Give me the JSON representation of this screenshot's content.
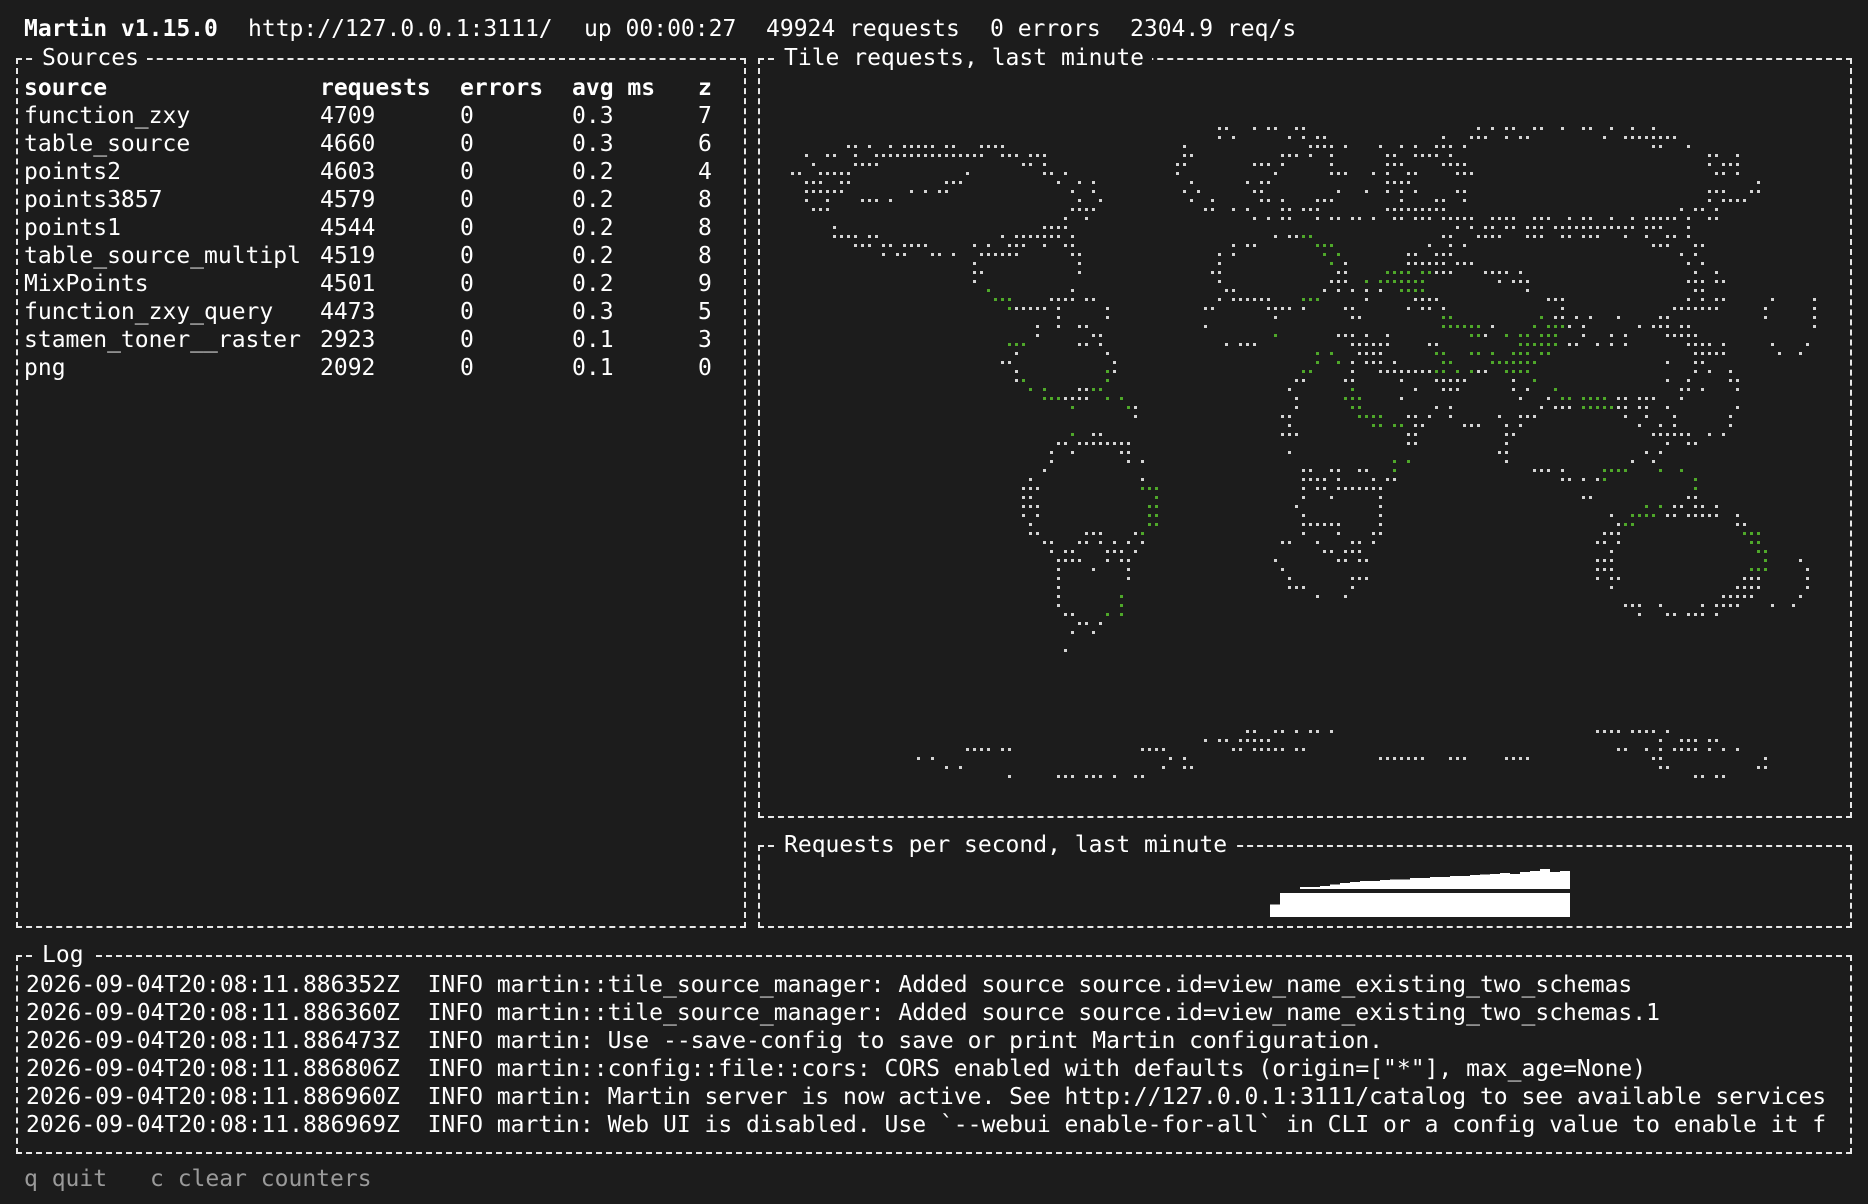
{
  "status": {
    "app": "Martin v1.15.0",
    "url": "http://127.0.0.1:3111/",
    "uptime": "up 00:00:27",
    "requests": "49924 requests",
    "errors": "0 errors",
    "rate": "2304.9 req/s"
  },
  "sources_panel": {
    "title": "Sources",
    "headers": [
      "source",
      "requests",
      "errors",
      "avg ms",
      "z"
    ],
    "rows": [
      {
        "source": "function_zxy",
        "requests": "4709",
        "errors": "0",
        "avg": "0.3",
        "z": "7"
      },
      {
        "source": "table_source",
        "requests": "4660",
        "errors": "0",
        "avg": "0.3",
        "z": "6"
      },
      {
        "source": "points2",
        "requests": "4603",
        "errors": "0",
        "avg": "0.2",
        "z": "4"
      },
      {
        "source": "points3857",
        "requests": "4579",
        "errors": "0",
        "avg": "0.2",
        "z": "8"
      },
      {
        "source": "points1",
        "requests": "4544",
        "errors": "0",
        "avg": "0.2",
        "z": "8"
      },
      {
        "source": "table_source_multipl",
        "requests": "4519",
        "errors": "0",
        "avg": "0.2",
        "z": "8"
      },
      {
        "source": "MixPoints",
        "requests": "4501",
        "errors": "0",
        "avg": "0.2",
        "z": "9"
      },
      {
        "source": "function_zxy_query",
        "requests": "4473",
        "errors": "0",
        "avg": "0.3",
        "z": "5"
      },
      {
        "source": "stamen_toner__raster",
        "requests": "2923",
        "errors": "0",
        "avg": "0.1",
        "z": "3"
      },
      {
        "source": "png",
        "requests": "2092",
        "errors": "0",
        "avg": "0.1",
        "z": "0"
      }
    ]
  },
  "map_panel": {
    "title": "Tile requests, last minute",
    "land_color": "#d4d4d4",
    "hit_color": "#4fa82a"
  },
  "rps_panel": {
    "title": "Requests per second, last minute",
    "values": [
      0.25,
      0.5,
      0.55,
      0.6,
      0.6,
      0.62,
      0.65,
      0.68,
      0.7,
      0.72,
      0.72,
      0.74,
      0.75,
      0.75,
      0.78,
      0.78,
      0.8,
      0.8,
      0.82,
      0.82,
      0.84,
      0.85,
      0.86,
      0.88,
      0.86,
      0.9,
      0.92,
      0.96,
      0.9,
      0.92
    ]
  },
  "log_panel": {
    "title": "Log",
    "lines": [
      "2026-09-04T20:08:11.886352Z  INFO martin::tile_source_manager: Added source source.id=view_name_existing_two_schemas",
      "2026-09-04T20:08:11.886360Z  INFO martin::tile_source_manager: Added source source.id=view_name_existing_two_schemas.1",
      "2026-09-04T20:08:11.886473Z  INFO martin: Use --save-config to save or print Martin configuration.",
      "2026-09-04T20:08:11.886806Z  INFO martin::config::file::cors: CORS enabled with defaults (origin=[\"*\"], max_age=None)",
      "2026-09-04T20:08:11.886960Z  INFO martin: Martin server is now active. See http://127.0.0.1:3111/catalog to see available services",
      "2026-09-04T20:08:11.886969Z  INFO martin: Web UI is disabled. Use `--webui enable-for-all` in CLI or a config value to enable it f"
    ]
  },
  "footer": {
    "quit": "q quit",
    "clear": "c clear counters"
  }
}
